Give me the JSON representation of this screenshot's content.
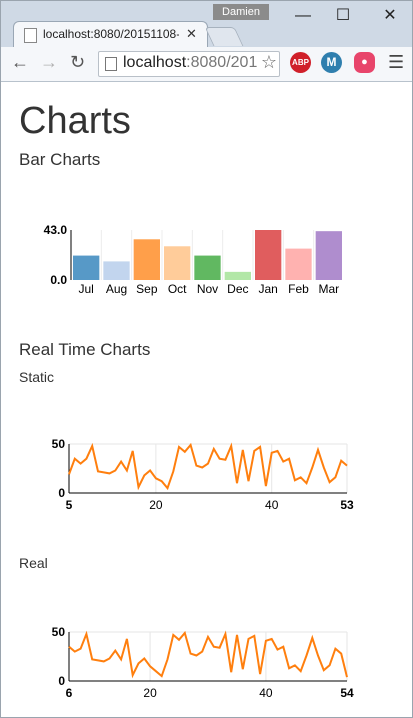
{
  "browser": {
    "user": "Damien",
    "tab_title": "localhost:8080/20151108-",
    "url_host": "localhost",
    "url_rest": ":8080/201",
    "ext_abp": "ABP",
    "ext_m": "M"
  },
  "page": {
    "title": "Charts",
    "bar_heading": "Bar Charts",
    "realtime_heading": "Real Time Charts",
    "static_label": "Static",
    "real_label": "Real"
  },
  "colors": {
    "line": "#ff7f0e",
    "grid": "#e6e6e6",
    "axis": "#000000"
  },
  "chart_data": [
    {
      "type": "bar",
      "categories": [
        "Jul",
        "Aug",
        "Sep",
        "Oct",
        "Nov",
        "Dec",
        "Jan",
        "Feb",
        "Mar"
      ],
      "values": [
        21,
        16,
        35,
        29,
        21,
        7,
        43,
        27,
        42
      ],
      "colors": [
        "#1f77b4",
        "#aec7e8",
        "#ff7f0e",
        "#ffbb78",
        "#2ca02c",
        "#98df8a",
        "#d62728",
        "#ff9896",
        "#9467bd"
      ],
      "y_ticks": [
        "0.0",
        "43.0"
      ],
      "ylim": [
        0,
        43
      ]
    },
    {
      "type": "line",
      "x": [
        5,
        6,
        7,
        8,
        9,
        10,
        11,
        12,
        13,
        14,
        15,
        16,
        17,
        18,
        19,
        20,
        21,
        22,
        23,
        24,
        25,
        26,
        27,
        28,
        29,
        30,
        31,
        32,
        33,
        34,
        35,
        36,
        37,
        38,
        39,
        40,
        41,
        42,
        43,
        44,
        45,
        46,
        47,
        48,
        49,
        50,
        51,
        52,
        53
      ],
      "values": [
        19,
        35,
        30,
        35,
        48,
        22,
        21,
        20,
        23,
        32,
        23,
        43,
        6,
        18,
        23,
        15,
        12,
        5,
        22,
        47,
        42,
        49,
        28,
        26,
        30,
        45,
        35,
        34,
        48,
        10,
        44,
        12,
        43,
        47,
        7,
        41,
        43,
        32,
        35,
        13,
        16,
        10,
        26,
        44,
        26,
        11,
        16,
        33,
        28
      ],
      "xlim": [
        5,
        53
      ],
      "ylim": [
        0,
        50
      ],
      "x_ticks": [
        "5",
        "20",
        "40",
        "53"
      ],
      "y_ticks": [
        "0",
        "50"
      ]
    },
    {
      "type": "line",
      "x": [
        6,
        7,
        8,
        9,
        10,
        11,
        12,
        13,
        14,
        15,
        16,
        17,
        18,
        19,
        20,
        21,
        22,
        23,
        24,
        25,
        26,
        27,
        28,
        29,
        30,
        31,
        32,
        33,
        34,
        35,
        36,
        37,
        38,
        39,
        40,
        41,
        42,
        43,
        44,
        45,
        46,
        47,
        48,
        49,
        50,
        51,
        52,
        53,
        54
      ],
      "values": [
        35,
        30,
        33,
        48,
        22,
        21,
        20,
        23,
        31,
        22,
        43,
        6,
        18,
        23,
        15,
        10,
        5,
        22,
        47,
        42,
        49,
        28,
        26,
        30,
        45,
        35,
        34,
        48,
        9,
        47,
        12,
        43,
        46,
        7,
        41,
        43,
        32,
        35,
        13,
        16,
        10,
        26,
        44,
        26,
        11,
        16,
        33,
        28,
        4
      ],
      "xlim": [
        6,
        54
      ],
      "ylim": [
        0,
        50
      ],
      "x_ticks": [
        "6",
        "20",
        "40",
        "54"
      ],
      "y_ticks": [
        "0",
        "50"
      ]
    }
  ]
}
